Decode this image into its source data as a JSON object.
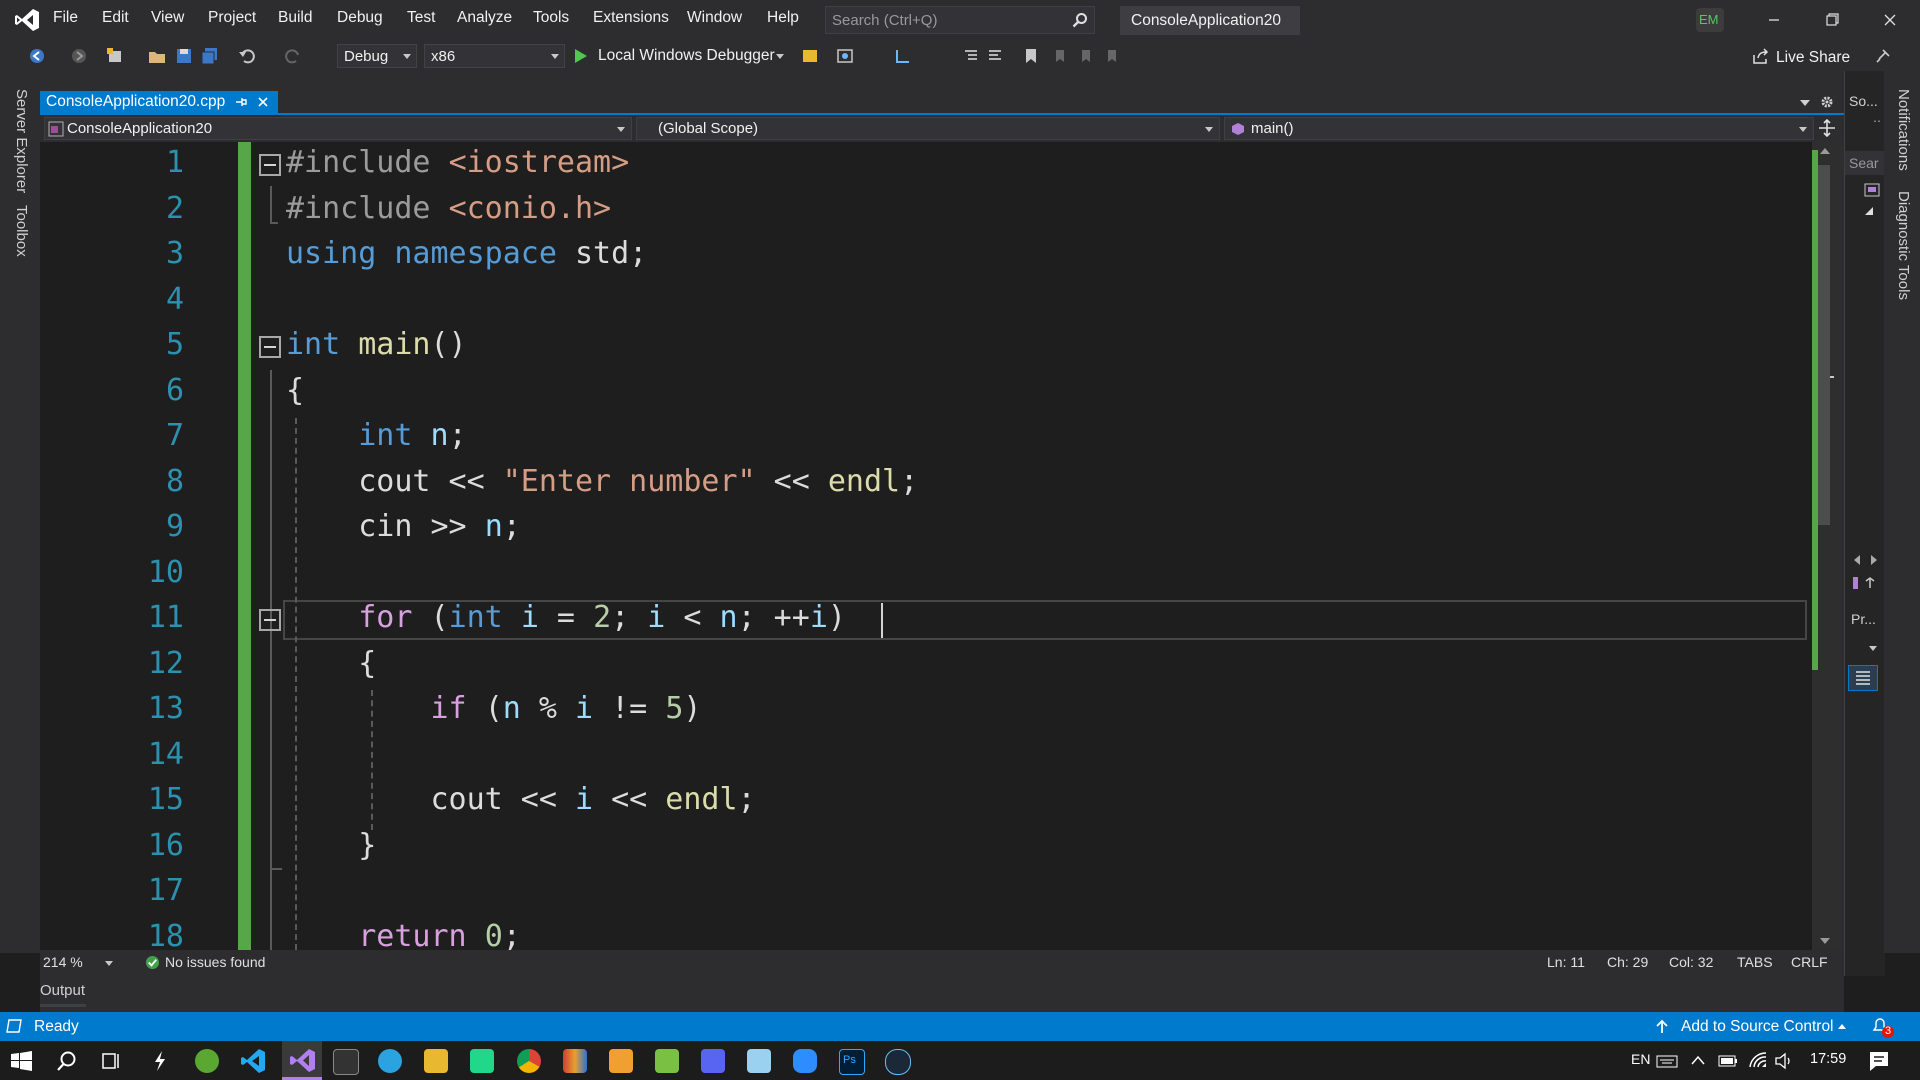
{
  "window": {
    "title": "ConsoleApplication20",
    "user_initials": "EM",
    "search_placeholder": "Search (Ctrl+Q)"
  },
  "menu": [
    "File",
    "Edit",
    "View",
    "Project",
    "Build",
    "Debug",
    "Test",
    "Analyze",
    "Tools",
    "Extensions",
    "Window",
    "Help"
  ],
  "toolbar": {
    "config": "Debug",
    "platform": "x86",
    "debugger": "Local Windows Debugger",
    "live_share": "Live Share"
  },
  "left_strip": [
    "Server Explorer",
    "Toolbox"
  ],
  "right_strip": [
    "Notifications",
    "Diagnostic Tools"
  ],
  "right_panel": {
    "solution_label": "So...",
    "search_label": "Sear",
    "properties_label": "Pr..."
  },
  "tab": {
    "file": "ConsoleApplication20.cpp"
  },
  "navbar": {
    "project": "ConsoleApplication20",
    "scope": "(Global Scope)",
    "member": "main()"
  },
  "code": {
    "line_numbers": [
      "1",
      "2",
      "3",
      "4",
      "5",
      "6",
      "7",
      "8",
      "9",
      "10",
      "11",
      "12",
      "13",
      "14",
      "15",
      "16",
      "17",
      "18"
    ],
    "lines": [
      [
        {
          "t": "#include ",
          "c": "pp"
        },
        {
          "t": "<iostream>",
          "c": "inc"
        }
      ],
      [
        {
          "t": "#include ",
          "c": "pp"
        },
        {
          "t": "<conio.h>",
          "c": "inc"
        }
      ],
      [
        {
          "t": "using ",
          "c": "kw"
        },
        {
          "t": "namespace ",
          "c": "kw"
        },
        {
          "t": "std;",
          "c": ""
        }
      ],
      [],
      [
        {
          "t": "int ",
          "c": "kw"
        },
        {
          "t": "main",
          "c": "fn"
        },
        {
          "t": "()",
          "c": ""
        }
      ],
      [
        {
          "t": "{",
          "c": ""
        }
      ],
      [
        {
          "t": "    ",
          "c": ""
        },
        {
          "t": "int ",
          "c": "kw"
        },
        {
          "t": "n",
          "c": "var"
        },
        {
          "t": ";",
          "c": ""
        }
      ],
      [
        {
          "t": "    cout << ",
          "c": ""
        },
        {
          "t": "\"Enter number\"",
          "c": "str"
        },
        {
          "t": " << ",
          "c": ""
        },
        {
          "t": "endl",
          "c": "fn"
        },
        {
          "t": ";",
          "c": ""
        }
      ],
      [
        {
          "t": "    cin >> ",
          "c": ""
        },
        {
          "t": "n",
          "c": "var"
        },
        {
          "t": ";",
          "c": ""
        }
      ],
      [],
      [
        {
          "t": "    ",
          "c": ""
        },
        {
          "t": "for ",
          "c": "ctl"
        },
        {
          "t": "(",
          "c": ""
        },
        {
          "t": "int ",
          "c": "kw"
        },
        {
          "t": "i",
          "c": "var"
        },
        {
          "t": " = ",
          "c": ""
        },
        {
          "t": "2",
          "c": "num"
        },
        {
          "t": "; ",
          "c": ""
        },
        {
          "t": "i",
          "c": "var"
        },
        {
          "t": " < ",
          "c": ""
        },
        {
          "t": "n",
          "c": "var"
        },
        {
          "t": "; ++",
          "c": ""
        },
        {
          "t": "i",
          "c": "var"
        },
        {
          "t": ")",
          "c": ""
        }
      ],
      [
        {
          "t": "    {",
          "c": ""
        }
      ],
      [
        {
          "t": "        ",
          "c": ""
        },
        {
          "t": "if ",
          "c": "ctl"
        },
        {
          "t": "(",
          "c": ""
        },
        {
          "t": "n",
          "c": "var"
        },
        {
          "t": " % ",
          "c": ""
        },
        {
          "t": "i",
          "c": "var"
        },
        {
          "t": " != ",
          "c": ""
        },
        {
          "t": "5",
          "c": "num"
        },
        {
          "t": ")",
          "c": ""
        }
      ],
      [],
      [
        {
          "t": "        cout << ",
          "c": ""
        },
        {
          "t": "i",
          "c": "var"
        },
        {
          "t": " << ",
          "c": ""
        },
        {
          "t": "endl",
          "c": "fn"
        },
        {
          "t": ";",
          "c": ""
        }
      ],
      [
        {
          "t": "    }",
          "c": ""
        }
      ],
      [],
      [
        {
          "t": "    ",
          "c": ""
        },
        {
          "t": "return ",
          "c": "ctl"
        },
        {
          "t": "0",
          "c": "num"
        },
        {
          "t": ";",
          "c": ""
        }
      ]
    ]
  },
  "editor_status": {
    "zoom": "214 %",
    "issues": "No issues found",
    "ln": "Ln: 11",
    "ch": "Ch: 29",
    "col": "Col: 32",
    "tabs": "TABS",
    "eol": "CRLF"
  },
  "output_label": "Output",
  "statusbar": {
    "ready": "Ready",
    "source_control": "Add to Source Control",
    "notifications_count": "3"
  },
  "taskbar": {
    "lang": "EN",
    "time": "17:59"
  },
  "colors": {
    "accent": "#007acc",
    "editor_bg": "#1e1e1e",
    "chrome": "#2d2d30",
    "change_bar": "#57a64a"
  }
}
